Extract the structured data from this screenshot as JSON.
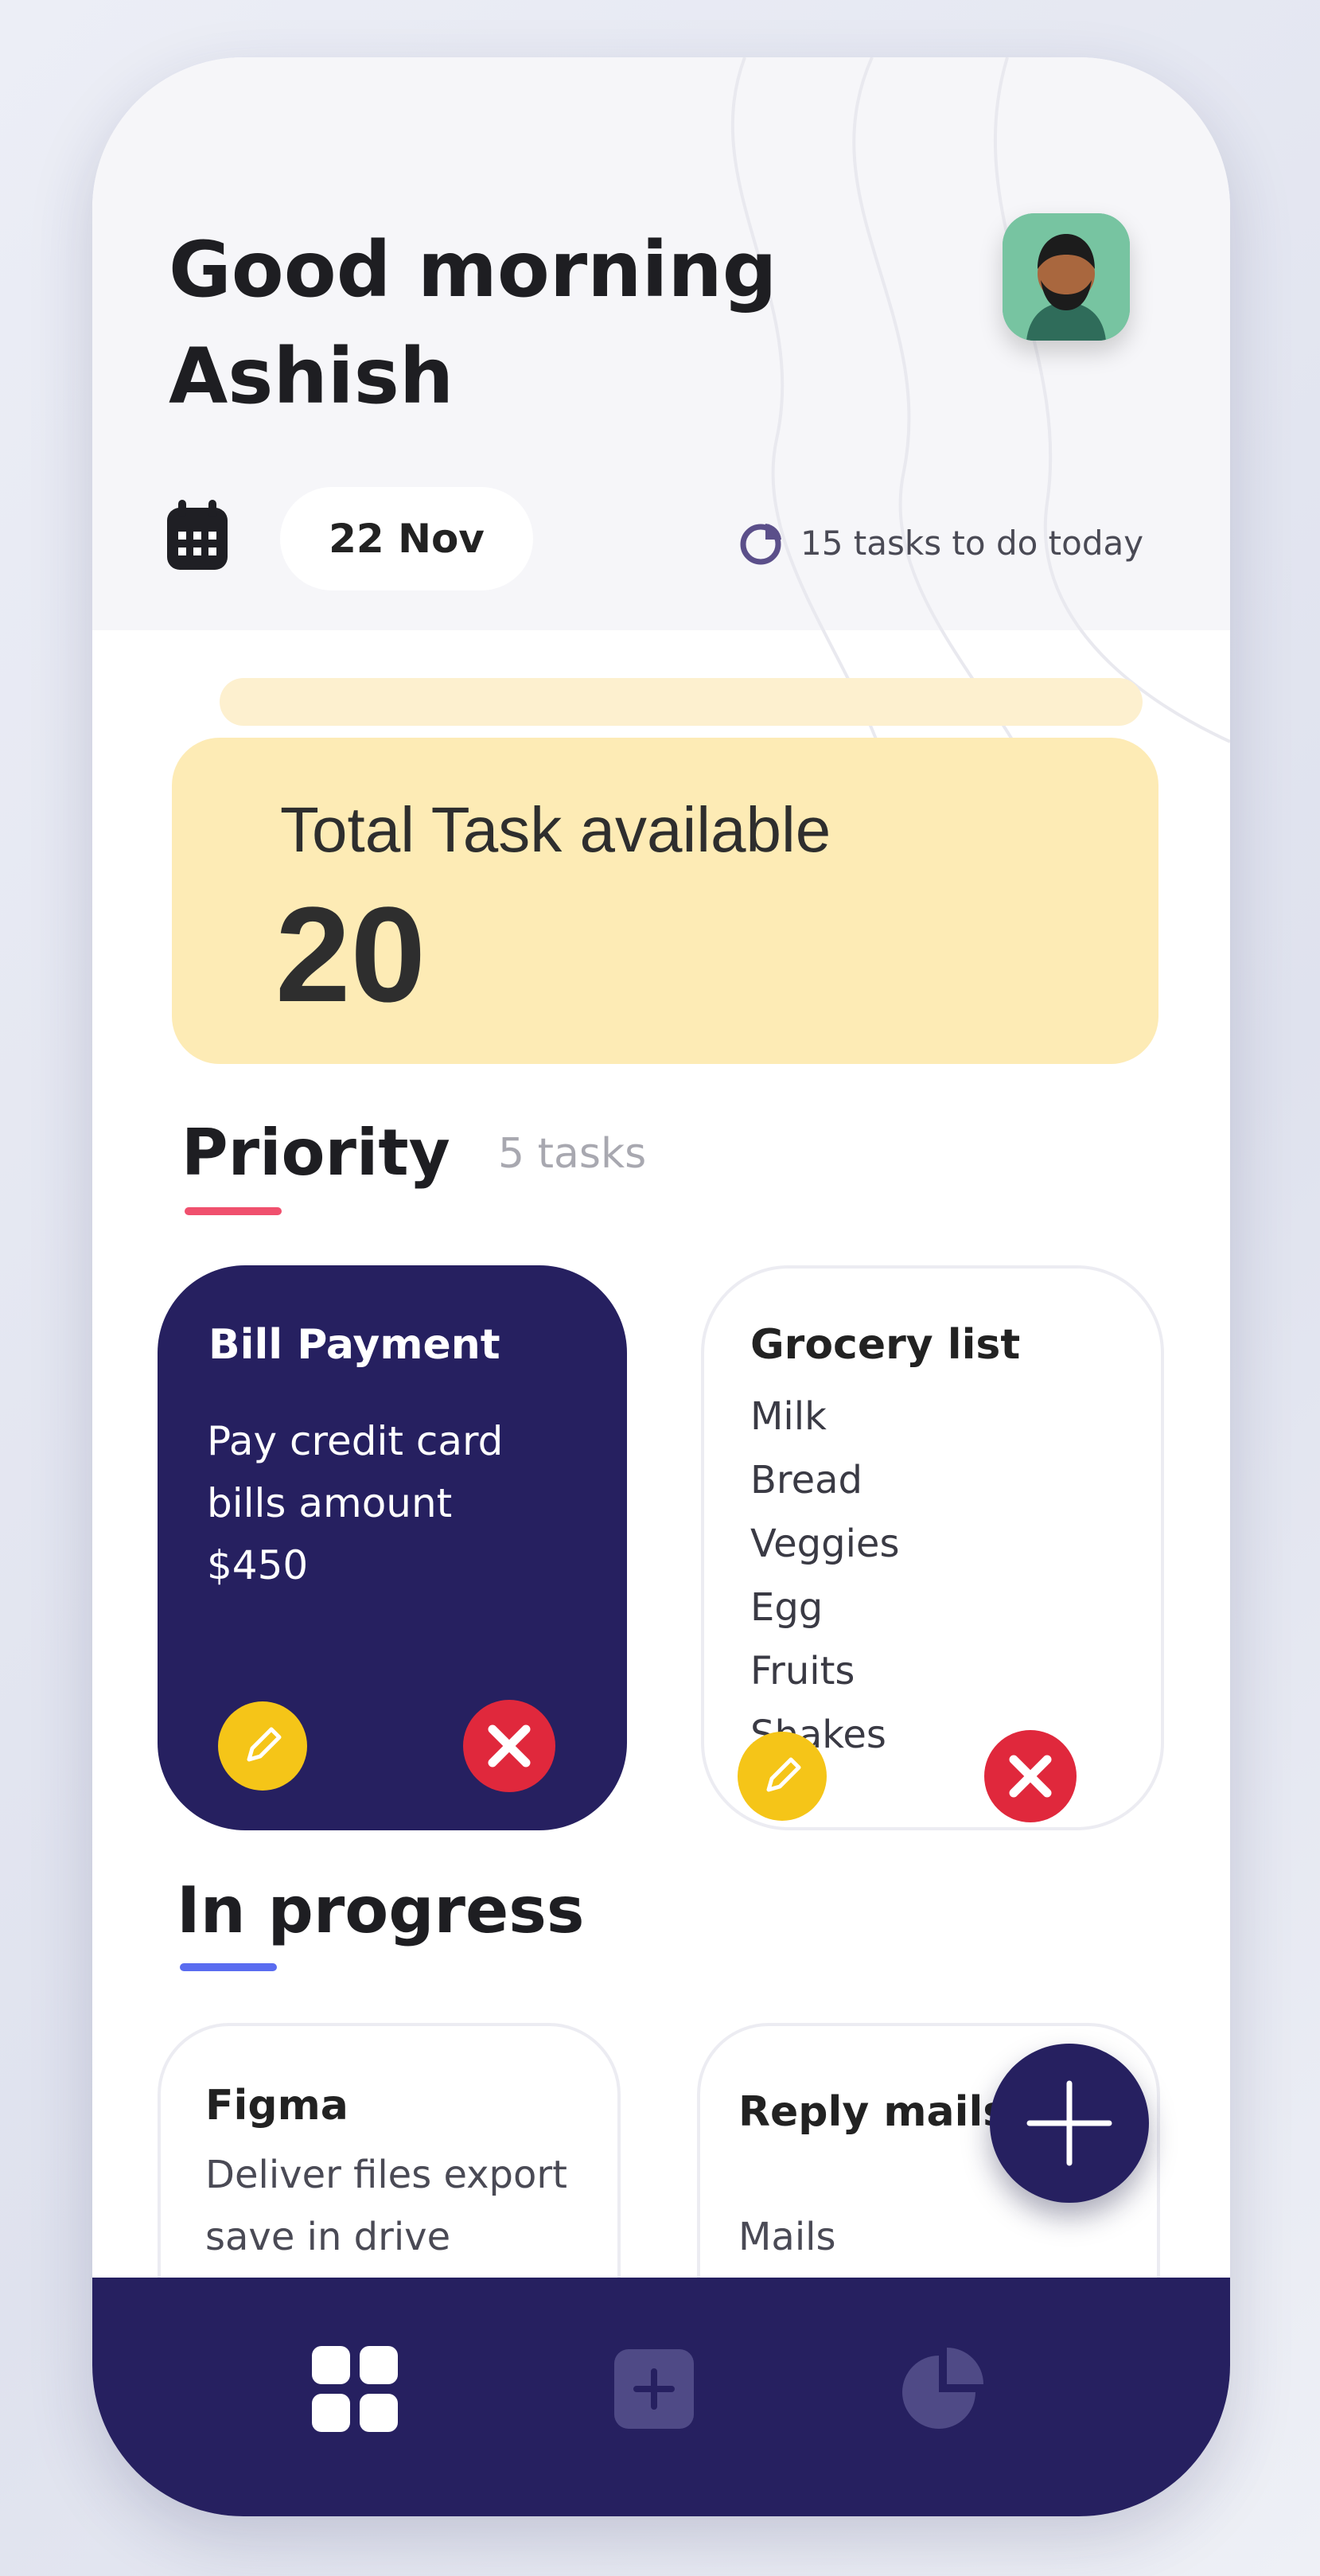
{
  "header": {
    "greeting_line1": "Good morning",
    "greeting_line2": "Ashish",
    "date": "22 Nov",
    "tasks_today": "15 tasks to do today"
  },
  "summary": {
    "label": "Total Task available",
    "value": "20"
  },
  "priority": {
    "title": "Priority",
    "count": "5 tasks",
    "underline_color": "#f0506e",
    "cards": [
      {
        "title": "Bill Payment",
        "description": [
          "Pay credit card",
          "bills amount",
          "$450"
        ]
      },
      {
        "title": "Grocery list",
        "items": [
          "Milk",
          "Bread",
          "Veggies",
          "Egg",
          "Fruits",
          "Shakes"
        ]
      }
    ]
  },
  "in_progress": {
    "title": "In progress",
    "underline_color": "#5a6cf0",
    "cards": [
      {
        "title": "Figma",
        "description": [
          "Deliver files export",
          "save in drive"
        ]
      },
      {
        "title": "Reply mails",
        "description": [
          "Mails"
        ]
      }
    ]
  },
  "icons": {
    "calendar": "calendar-icon",
    "tasks": "pie-chart-icon",
    "edit": "pencil-icon",
    "delete": "close-icon",
    "fab": "plus-icon",
    "nav": [
      "grid-icon",
      "add-square-icon",
      "pie-chart-icon"
    ]
  },
  "colors": {
    "primary": "#262060",
    "summary_card": "#fdebb5",
    "edit_button": "#f5c518",
    "delete_button": "#e0283c"
  }
}
